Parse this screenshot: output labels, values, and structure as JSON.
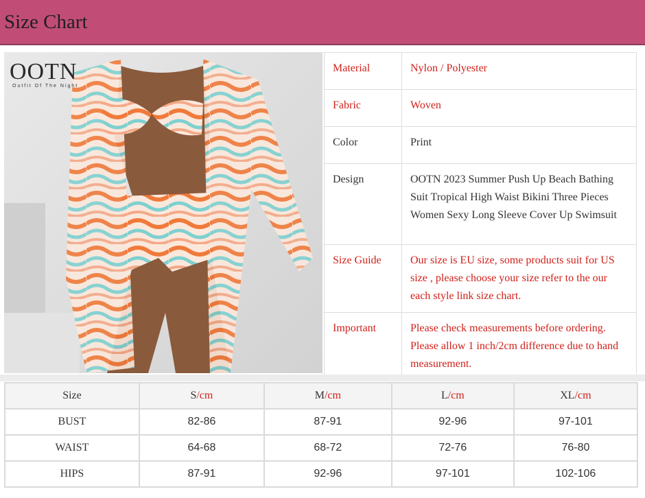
{
  "header": {
    "title": "Size Chart"
  },
  "brand": {
    "logo_text": "OOTN",
    "logo_subtext": "Outfit Of The Night"
  },
  "specs": [
    {
      "label": "Material",
      "value": "Nylon / Polyester",
      "label_color": "#d0201a",
      "value_color": "#d0201a"
    },
    {
      "label": "Fabric",
      "value": "Woven",
      "label_color": "#d0201a",
      "value_color": "#d0201a"
    },
    {
      "label": "Color",
      "value": "Print",
      "label_color": "#333333",
      "value_color": "#333333"
    },
    {
      "label": "Design",
      "value": "OOTN 2023 Summer Push Up Beach Bathing Suit Tropical High Waist Bikini Three Pieces Women Sexy Long Sleeve Cover Up Swimsuit",
      "label_color": "#333333",
      "value_color": "#333333"
    },
    {
      "label": "Size Guide",
      "value": "Our size is EU size, some products suit for US size , please choose your size refer to the our each style link size chart.",
      "label_color": "#d0201a",
      "value_color": "#d0201a"
    },
    {
      "label": "Important",
      "value": "Please check measurements before ordering. Please allow 1 inch/2cm difference due to hand measurement.",
      "label_color": "#d0201a",
      "value_color": "#d0201a"
    }
  ],
  "size_table": {
    "corner": "Size",
    "unit": "/cm",
    "sizes": [
      "S",
      "M",
      "L",
      "XL"
    ],
    "rows": [
      {
        "label": "BUST",
        "values": [
          "82-86",
          "87-91",
          "92-96",
          "97-101"
        ]
      },
      {
        "label": "WAIST",
        "values": [
          "64-68",
          "68-72",
          "72-76",
          "76-80"
        ]
      },
      {
        "label": "HIPS",
        "values": [
          "87-91",
          "92-96",
          "97-101",
          "102-106"
        ]
      }
    ]
  },
  "colors": {
    "header": "#c14d77",
    "accent_red": "#d0201a"
  }
}
